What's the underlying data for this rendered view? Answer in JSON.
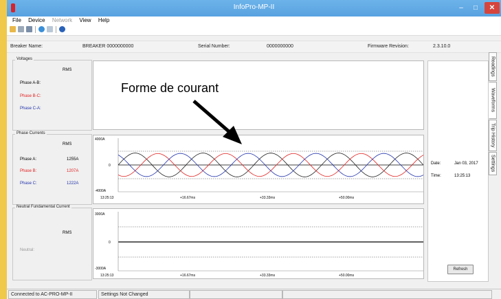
{
  "window": {
    "title": "InfoPro-MP-II"
  },
  "menu": {
    "file": "File",
    "device": "Device",
    "network": "Network",
    "view": "View",
    "help": "Help"
  },
  "toolbar_icons": [
    "open-icon",
    "save-icon",
    "save-as-icon",
    "refresh-icon",
    "download-icon",
    "help-icon"
  ],
  "info": {
    "breaker_label": "Breaker Name:",
    "breaker_value": "BREAKER 0000000000",
    "serial_label": "Serial Number:",
    "serial_value": "0000000000",
    "firmware_label": "Firmware Revision:",
    "firmware_value": "2.3.10.0"
  },
  "voltages": {
    "title": "Voltages",
    "rms": "RMS",
    "phase_a": "Phase A-B:",
    "phase_b": "Phase B-C:",
    "phase_c": "Phase C-A:"
  },
  "currents": {
    "title": "Phase Currents",
    "rms": "RMS",
    "phase_a": "Phase A:",
    "phase_a_val": "1255A",
    "phase_b": "Phase B:",
    "phase_b_val": "1207A",
    "phase_c": "Phase C:",
    "phase_c_val": "1222A",
    "y_max": "4000A",
    "y_zero": "0",
    "y_min": "-4000A"
  },
  "neutral": {
    "title": "Neutral Fundamental Current",
    "rms": "RMS",
    "neutral": "Neutral:",
    "y_max": "3000A",
    "y_zero": "0",
    "y_min": "-3000A"
  },
  "time_ticks": [
    "13:25:13",
    "+16.67ms",
    "+33.33ms",
    "+50.00ms"
  ],
  "side": {
    "date_label": "Date:",
    "date_value": "Jan 03, 2017",
    "time_label": "Time:",
    "time_value": "13:25:13",
    "refresh": "Refresh"
  },
  "tabs": [
    "Readings",
    "Waveforms",
    "Trip History",
    "Settings"
  ],
  "status": {
    "connection": "Connected to AC-PRO-MP-II",
    "settings": "Settings Not Changed"
  },
  "annotation": "Forme de courant",
  "colors": {
    "phase_a": "#222222",
    "phase_b": "#e02020",
    "phase_c": "#2233aa",
    "titlebar": "#5aa5e2"
  },
  "chart_data": {
    "type": "line",
    "title": "",
    "x": [
      "13:25:13",
      "+16.67ms",
      "+33.33ms",
      "+50.00ms"
    ],
    "ylim": [
      -4000,
      4000
    ],
    "series": [
      {
        "name": "Phase A",
        "rms": 1255,
        "cycles": 4.5,
        "phase_deg": 0
      },
      {
        "name": "Phase B",
        "rms": 1207,
        "cycles": 4.5,
        "phase_deg": -120
      },
      {
        "name": "Phase C",
        "rms": 1222,
        "cycles": 4.5,
        "phase_deg": 120
      }
    ]
  }
}
